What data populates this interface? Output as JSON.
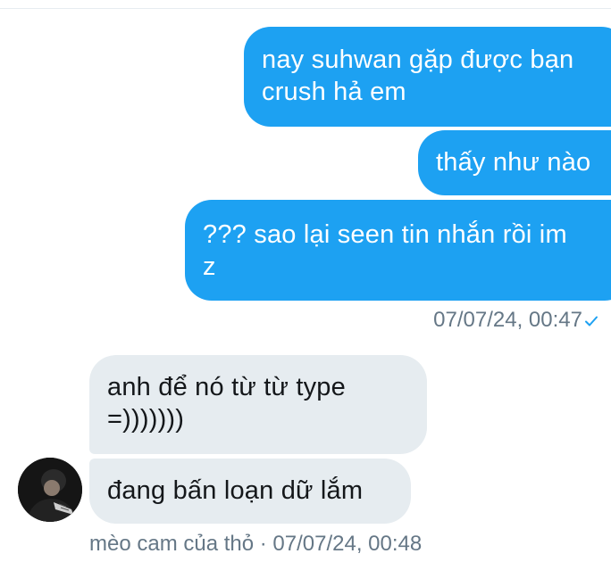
{
  "conversation": {
    "sent_messages": [
      {
        "text": "nay suhwan gặp được bạn\ncrush hả em"
      },
      {
        "text": "thấy như nào"
      },
      {
        "text": "??? sao lại seen tin nhắn rồi im\nz"
      }
    ],
    "sent_timestamp": "07/07/24, 00:47",
    "received_messages": [
      {
        "text": "anh để nó từ từ type\n=)))))))"
      },
      {
        "text": "đang bấn loạn dữ lắm"
      }
    ],
    "received_meta": "mèo cam của thỏ · 07/07/24, 00:48"
  },
  "icons": {
    "read_receipt": "check-icon",
    "sender_avatar": "avatar"
  },
  "colors": {
    "sent_bubble": "#1da1f2",
    "received_bubble": "#e6ecf0",
    "meta_text": "#657786"
  }
}
